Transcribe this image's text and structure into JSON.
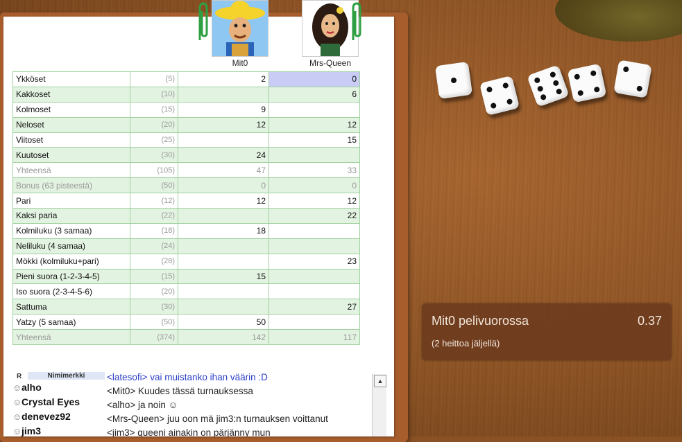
{
  "players": [
    {
      "name": "Mit0"
    },
    {
      "name": "Mrs-Queen"
    }
  ],
  "scorecard": {
    "rows": [
      {
        "name": "Ykköset",
        "max": "(5)",
        "p1": "2",
        "p2": "0",
        "style": "normal"
      },
      {
        "name": "Kakkoset",
        "max": "(10)",
        "p1": "",
        "p2": "6",
        "style": "alt"
      },
      {
        "name": "Kolmoset",
        "max": "(15)",
        "p1": "9",
        "p2": "",
        "style": "normal"
      },
      {
        "name": "Neloset",
        "max": "(20)",
        "p1": "12",
        "p2": "12",
        "style": "alt"
      },
      {
        "name": "Viitoset",
        "max": "(25)",
        "p1": "",
        "p2": "15",
        "style": "normal"
      },
      {
        "name": "Kuutoset",
        "max": "(30)",
        "p1": "24",
        "p2": "",
        "style": "alt"
      },
      {
        "name": "Yhteensä",
        "max": "(105)",
        "p1": "47",
        "p2": "33",
        "style": "sub"
      },
      {
        "name": "Bonus (63 pisteestä)",
        "max": "(50)",
        "p1": "0",
        "p2": "0",
        "style": "subalt"
      },
      {
        "name": "Pari",
        "max": "(12)",
        "p1": "12",
        "p2": "12",
        "style": "normal"
      },
      {
        "name": "Kaksi paria",
        "max": "(22)",
        "p1": "",
        "p2": "22",
        "style": "alt"
      },
      {
        "name": "Kolmiluku (3 samaa)",
        "max": "(18)",
        "p1": "18",
        "p2": "",
        "style": "normal"
      },
      {
        "name": "Neliluku (4 samaa)",
        "max": "(24)",
        "p1": "",
        "p2": "",
        "style": "alt"
      },
      {
        "name": "Mökki (kolmiluku+pari)",
        "max": "(28)",
        "p1": "",
        "p2": "23",
        "style": "normal"
      },
      {
        "name": "Pieni suora (1-2-3-4-5)",
        "max": "(15)",
        "p1": "15",
        "p2": "",
        "style": "alt"
      },
      {
        "name": "Iso suora (2-3-4-5-6)",
        "max": "(20)",
        "p1": "",
        "p2": "",
        "style": "normal"
      },
      {
        "name": "Sattuma",
        "max": "(30)",
        "p1": "",
        "p2": "27",
        "style": "alt"
      },
      {
        "name": "Yatzy (5 samaa)",
        "max": "(50)",
        "p1": "50",
        "p2": "",
        "style": "normal"
      },
      {
        "name": "Yhteensä",
        "max": "(374)",
        "p1": "142",
        "p2": "117",
        "style": "subalt"
      }
    ]
  },
  "dice": [
    {
      "value": 1
    },
    {
      "value": 4
    },
    {
      "value": 6
    },
    {
      "value": 4
    },
    {
      "value": 2
    }
  ],
  "status": {
    "turn_text": "Mit0 pelivuorossa",
    "time": "0.37",
    "rolls_left": "(2 heittoa jäljellä)"
  },
  "chat": {
    "users_header_r": "R",
    "users_header_nick": "Nimimerkki",
    "users": [
      "alho",
      "Crystal Eyes",
      "denevez92",
      "jim3"
    ],
    "messages": [
      {
        "text": "<latesofi> vai muistanko ihan väärin :D",
        "color": "blue"
      },
      {
        "text": "<Mit0> Kuudes tässä turnauksessa",
        "color": "normal"
      },
      {
        "text": "<alho> ja noin ☺",
        "color": "normal"
      },
      {
        "text": "<Mrs-Queen> juu oon mä jim3:n turnauksen voittanut",
        "color": "normal"
      },
      {
        "text": "<jim3> queeni ainakin on pärjänny mun",
        "color": "normal"
      }
    ]
  },
  "colors": {
    "active_cell": "#c9ccf4",
    "grid_green": "#9ed09e",
    "row_alt": "#e3f3e1"
  }
}
